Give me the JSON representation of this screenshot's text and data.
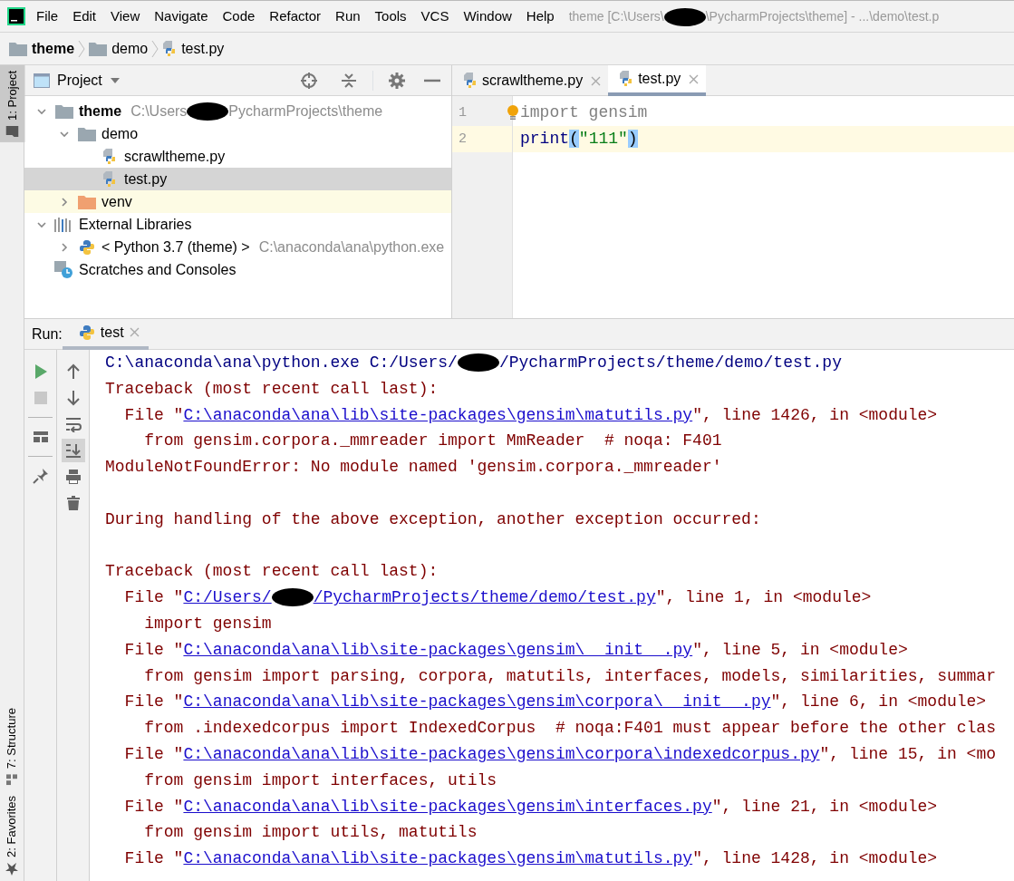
{
  "menu": [
    "File",
    "Edit",
    "View",
    "Navigate",
    "Code",
    "Refactor",
    "Run",
    "Tools",
    "VCS",
    "Window",
    "Help"
  ],
  "window_title": [
    {
      "kind": "text",
      "text": "theme [C:\\Users\\"
    },
    {
      "kind": "redaction"
    },
    {
      "kind": "text",
      "text": "\\PycharmProjects\\theme] - ...\\demo\\test.p"
    }
  ],
  "breadcrumb": [
    {
      "label": "theme",
      "kind": "folder",
      "bold": true
    },
    {
      "label": "demo",
      "kind": "folder",
      "bold": false
    },
    {
      "label": "test.py",
      "kind": "pyfile",
      "bold": false
    }
  ],
  "tool_stripe": [
    {
      "label": "1: Project",
      "selected": true,
      "kind": "project"
    },
    {
      "label": "7: Structure",
      "selected": false,
      "kind": "structure"
    },
    {
      "label": "2: Favorites",
      "selected": false,
      "kind": "favorites"
    }
  ],
  "project_panel": {
    "title": "Project",
    "tree": [
      {
        "label": "theme",
        "kind": "folder",
        "bold": true,
        "expanded": true,
        "selected": false,
        "highlighted": false,
        "hint": [
          {
            "kind": "text",
            "text": "C:\\Users"
          },
          {
            "kind": "redaction"
          },
          {
            "kind": "text",
            "text": "PycharmProjects\\theme"
          }
        ],
        "children": [
          {
            "label": "demo",
            "kind": "folder",
            "bold": false,
            "expanded": true,
            "selected": false,
            "highlighted": false,
            "children": [
              {
                "label": "scrawltheme.py",
                "kind": "pyfile",
                "bold": false,
                "selected": false,
                "highlighted": false
              },
              {
                "label": "test.py",
                "kind": "pyfile",
                "bold": false,
                "selected": true,
                "highlighted": false
              }
            ]
          },
          {
            "label": "venv",
            "kind": "excluded",
            "bold": false,
            "expanded": false,
            "selected": false,
            "highlighted": true
          }
        ]
      },
      {
        "label": "External Libraries",
        "kind": "library",
        "bold": false,
        "expanded": true,
        "selected": false,
        "highlighted": false,
        "children": [
          {
            "label": "< Python 3.7 (theme) >",
            "kind": "python",
            "bold": false,
            "expanded": false,
            "selected": false,
            "highlighted": false,
            "hint": [
              {
                "kind": "text",
                "text": "C:\\anaconda\\ana\\python.exe"
              }
            ]
          }
        ]
      },
      {
        "label": "Scratches and Consoles",
        "kind": "scratches",
        "bold": false,
        "selected": false,
        "highlighted": false
      }
    ]
  },
  "editor": {
    "tabs": [
      {
        "label": "scrawltheme.py",
        "selected": false
      },
      {
        "label": "test.py",
        "selected": true
      }
    ],
    "lines": [
      {
        "number": "1",
        "current": false,
        "bulb": true,
        "tokens": [
          {
            "kind": "unused",
            "text": "import gensim"
          }
        ]
      },
      {
        "number": "2",
        "current": true,
        "bulb": false,
        "tokens": [
          {
            "kind": "builtin",
            "text": "print"
          },
          {
            "kind": "brace",
            "text": "("
          },
          {
            "kind": "string",
            "text": "\"111\""
          },
          {
            "kind": "brace",
            "text": ")"
          }
        ]
      }
    ]
  },
  "run": {
    "label": "Run:",
    "tabs": [
      {
        "label": "test",
        "selected": true
      }
    ],
    "autoscroll": true,
    "console": [
      {
        "kind": "command",
        "segments": [
          {
            "kind": "text",
            "text": "C:\\anaconda\\ana\\python.exe C:/Users/"
          },
          {
            "kind": "redaction"
          },
          {
            "kind": "text",
            "text": "/PycharmProjects/theme/demo/test.py"
          }
        ]
      },
      {
        "kind": "error",
        "segments": [
          {
            "kind": "text",
            "text": "Traceback (most recent call last):"
          }
        ]
      },
      {
        "kind": "error",
        "segments": [
          {
            "kind": "text",
            "text": "  File \""
          },
          {
            "kind": "link",
            "text": "C:\\anaconda\\ana\\lib\\site-packages\\gensim\\matutils.py"
          },
          {
            "kind": "text",
            "text": "\", line 1426, in <module>"
          }
        ]
      },
      {
        "kind": "error",
        "segments": [
          {
            "kind": "text",
            "text": "    from gensim.corpora._mmreader import MmReader  # noqa: F401"
          }
        ]
      },
      {
        "kind": "error",
        "segments": [
          {
            "kind": "text",
            "text": "ModuleNotFoundError: No module named 'gensim.corpora._mmreader'"
          }
        ]
      },
      {
        "kind": "blank"
      },
      {
        "kind": "error",
        "segments": [
          {
            "kind": "text",
            "text": "During handling of the above exception, another exception occurred:"
          }
        ]
      },
      {
        "kind": "blank"
      },
      {
        "kind": "error",
        "segments": [
          {
            "kind": "text",
            "text": "Traceback (most recent call last):"
          }
        ]
      },
      {
        "kind": "error",
        "segments": [
          {
            "kind": "text",
            "text": "  File \""
          },
          {
            "kind": "link",
            "text": "C:/Users/"
          },
          {
            "kind": "redaction"
          },
          {
            "kind": "link",
            "text": "/PycharmProjects/theme/demo/test.py"
          },
          {
            "kind": "text",
            "text": "\", line 1, in <module>"
          }
        ]
      },
      {
        "kind": "error",
        "segments": [
          {
            "kind": "text",
            "text": "    import gensim"
          }
        ]
      },
      {
        "kind": "error",
        "segments": [
          {
            "kind": "text",
            "text": "  File \""
          },
          {
            "kind": "link",
            "text": "C:\\anaconda\\ana\\lib\\site-packages\\gensim\\__init__.py"
          },
          {
            "kind": "text",
            "text": "\", line 5, in <module>"
          }
        ]
      },
      {
        "kind": "error",
        "segments": [
          {
            "kind": "text",
            "text": "    from gensim import parsing, corpora, matutils, interfaces, models, similarities, summar"
          }
        ]
      },
      {
        "kind": "error",
        "segments": [
          {
            "kind": "text",
            "text": "  File \""
          },
          {
            "kind": "link",
            "text": "C:\\anaconda\\ana\\lib\\site-packages\\gensim\\corpora\\__init__.py"
          },
          {
            "kind": "text",
            "text": "\", line 6, in <module>"
          }
        ]
      },
      {
        "kind": "error",
        "segments": [
          {
            "kind": "text",
            "text": "    from .indexedcorpus import IndexedCorpus  # noqa:F401 must appear before the other clas"
          }
        ]
      },
      {
        "kind": "error",
        "segments": [
          {
            "kind": "text",
            "text": "  File \""
          },
          {
            "kind": "link",
            "text": "C:\\anaconda\\ana\\lib\\site-packages\\gensim\\corpora\\indexedcorpus.py"
          },
          {
            "kind": "text",
            "text": "\", line 15, in <mo"
          }
        ]
      },
      {
        "kind": "error",
        "segments": [
          {
            "kind": "text",
            "text": "    from gensim import interfaces, utils"
          }
        ]
      },
      {
        "kind": "error",
        "segments": [
          {
            "kind": "text",
            "text": "  File \""
          },
          {
            "kind": "link",
            "text": "C:\\anaconda\\ana\\lib\\site-packages\\gensim\\interfaces.py"
          },
          {
            "kind": "text",
            "text": "\", line 21, in <module>"
          }
        ]
      },
      {
        "kind": "error",
        "segments": [
          {
            "kind": "text",
            "text": "    from gensim import utils, matutils"
          }
        ]
      },
      {
        "kind": "error",
        "segments": [
          {
            "kind": "text",
            "text": "  File \""
          },
          {
            "kind": "link",
            "text": "C:\\anaconda\\ana\\lib\\site-packages\\gensim\\matutils.py"
          },
          {
            "kind": "text",
            "text": "\", line 1428, in <module>"
          }
        ]
      }
    ]
  }
}
